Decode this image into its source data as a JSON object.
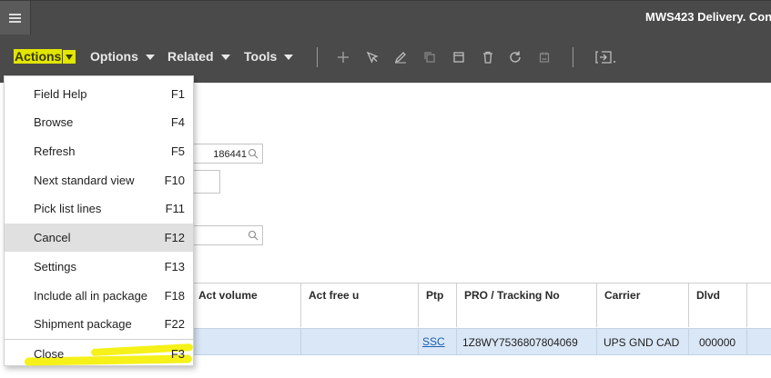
{
  "window": {
    "title": "MWS423 Delivery. Con"
  },
  "menubar": {
    "tabs": [
      {
        "label": "Actions",
        "icon": "chevron-down-icon"
      },
      {
        "label": "Options",
        "icon": "chevron-down-icon"
      },
      {
        "label": "Related",
        "icon": "chevron-down-icon"
      },
      {
        "label": "Tools",
        "icon": "chevron-down-icon"
      }
    ],
    "actions_highlight_color": "#e2e600"
  },
  "toolbar_icons": [
    "add-icon",
    "cursor-icon",
    "edit-icon",
    "copy-icon",
    "display-icon",
    "delete-icon",
    "refresh-icon",
    "cancel-icon",
    "exit-icon"
  ],
  "form": {
    "field1_value": "186441",
    "field2_value": "",
    "field3_value": ""
  },
  "grid": {
    "headers": [
      "Act volume",
      "Act free u",
      "Ptp",
      "PRO / Tracking No",
      "Carrier",
      "Dlvd"
    ],
    "row": [
      "",
      "",
      "SSC",
      "1Z8WY7536807804069",
      "UPS GND CAD",
      "000000"
    ],
    "selected_row_color": "#dae7f6"
  },
  "actions_menu": {
    "items": [
      {
        "label": "Field Help",
        "key": "F1"
      },
      {
        "label": "Browse",
        "key": "F4"
      },
      {
        "label": "Refresh",
        "key": "F5"
      },
      {
        "label": "Next standard view",
        "key": "F10"
      },
      {
        "label": "Pick list lines",
        "key": "F11"
      },
      {
        "label": "Cancel",
        "key": "F12"
      },
      {
        "label": "Settings",
        "key": "F13"
      },
      {
        "label": "Include all in package",
        "key": "F18"
      },
      {
        "label": "Shipment package",
        "key": "F22"
      },
      {
        "label": "Close",
        "key": "F3"
      }
    ],
    "active_item": "Cancel",
    "annotation_color": "#f4f000"
  }
}
